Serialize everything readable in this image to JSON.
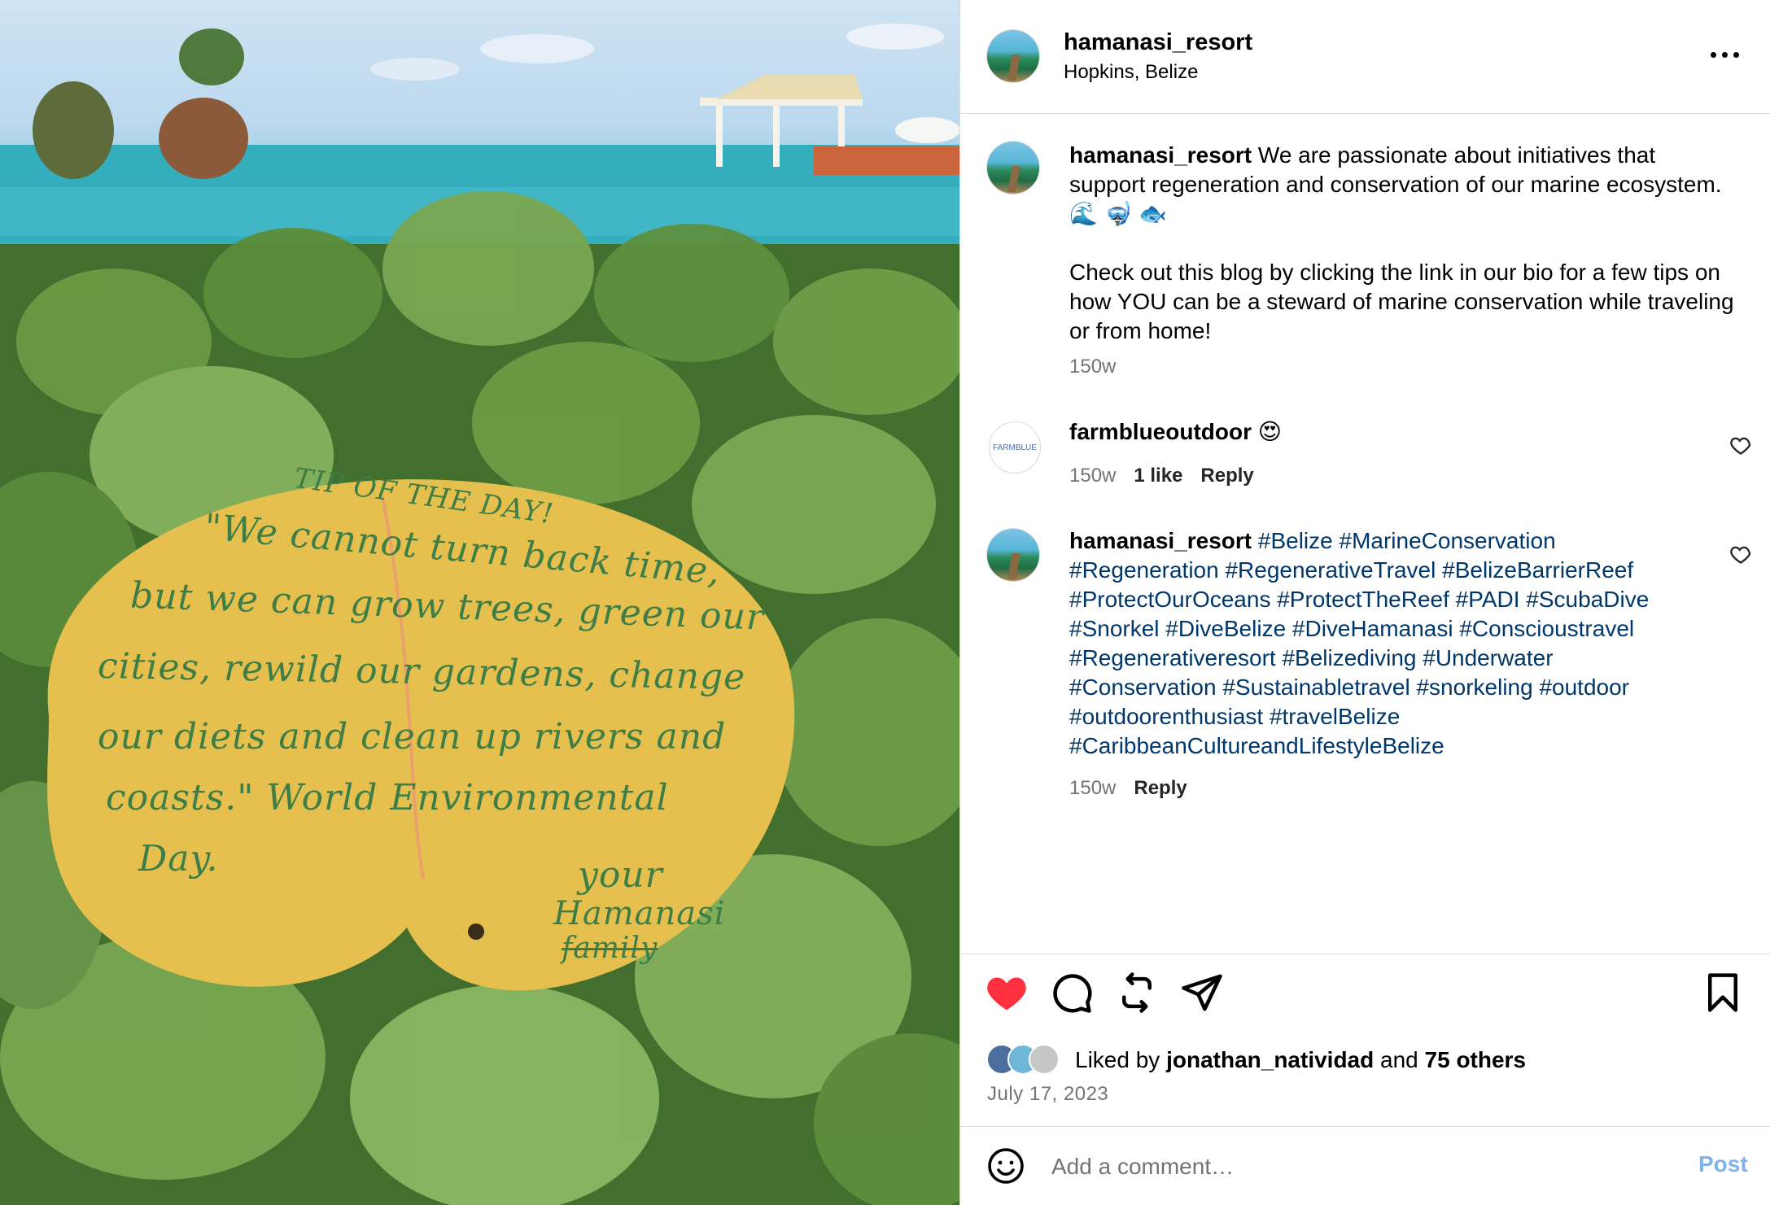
{
  "post_image": {
    "note_lines": [
      "TIP OF THE DAY!",
      "\"We cannot turn back time,",
      "but we can grow trees, green our",
      "cities, rewild our gardens, change",
      "our diets and clean up rivers and",
      "coasts.\" World  Environmental",
      "Day.",
      "your",
      "Hamanasi",
      "family"
    ]
  },
  "header": {
    "username": "hamanasi_resort",
    "location": "Hopkins, Belize",
    "more_icon": "more-horizontal-icon"
  },
  "caption": {
    "username": "hamanasi_resort",
    "text_1": "We are passionate about initiatives that support regeneration and conservation of our marine ecosystem.🌊 🤿 🐟",
    "text_2": "Check out this blog by clicking the link in our bio for a few tips on how YOU can be a steward of marine conservation while traveling or from home!",
    "age": "150w"
  },
  "comments": [
    {
      "username": "farmblueoutdoor",
      "avatar_text": "FARMBLUE",
      "text": "😍",
      "age": "150w",
      "likes": "1 like",
      "reply_label": "Reply"
    },
    {
      "username": "hamanasi_resort",
      "text": "#Belize #MarineConservation #Regeneration #RegenerativeTravel #BelizeBarrierReef #ProtectOurOceans #ProtectTheReef #PADI #ScubaDive #Snorkel #DiveBelize #DiveHamanasi #Conscioustravel #Regenerativeresort #Belizediving #Underwater #Conservation #Sustainabletravel #snorkeling #outdoor #outdoorenthusiast #travelBelize #CaribbeanCultureandLifestyleBelize",
      "age": "150w",
      "reply_label": "Reply"
    }
  ],
  "likes": {
    "prefix": "Liked by",
    "user": "jonathan_natividad",
    "joiner": "and",
    "others": "75 others",
    "date": "July 17, 2023"
  },
  "composer": {
    "placeholder": "Add a comment…",
    "post_label": "Post"
  },
  "colors": {
    "like_red": "#ff3040",
    "hashtag_blue": "#00376b",
    "post_blue": "#7fb3ec",
    "muted": "#737373"
  }
}
